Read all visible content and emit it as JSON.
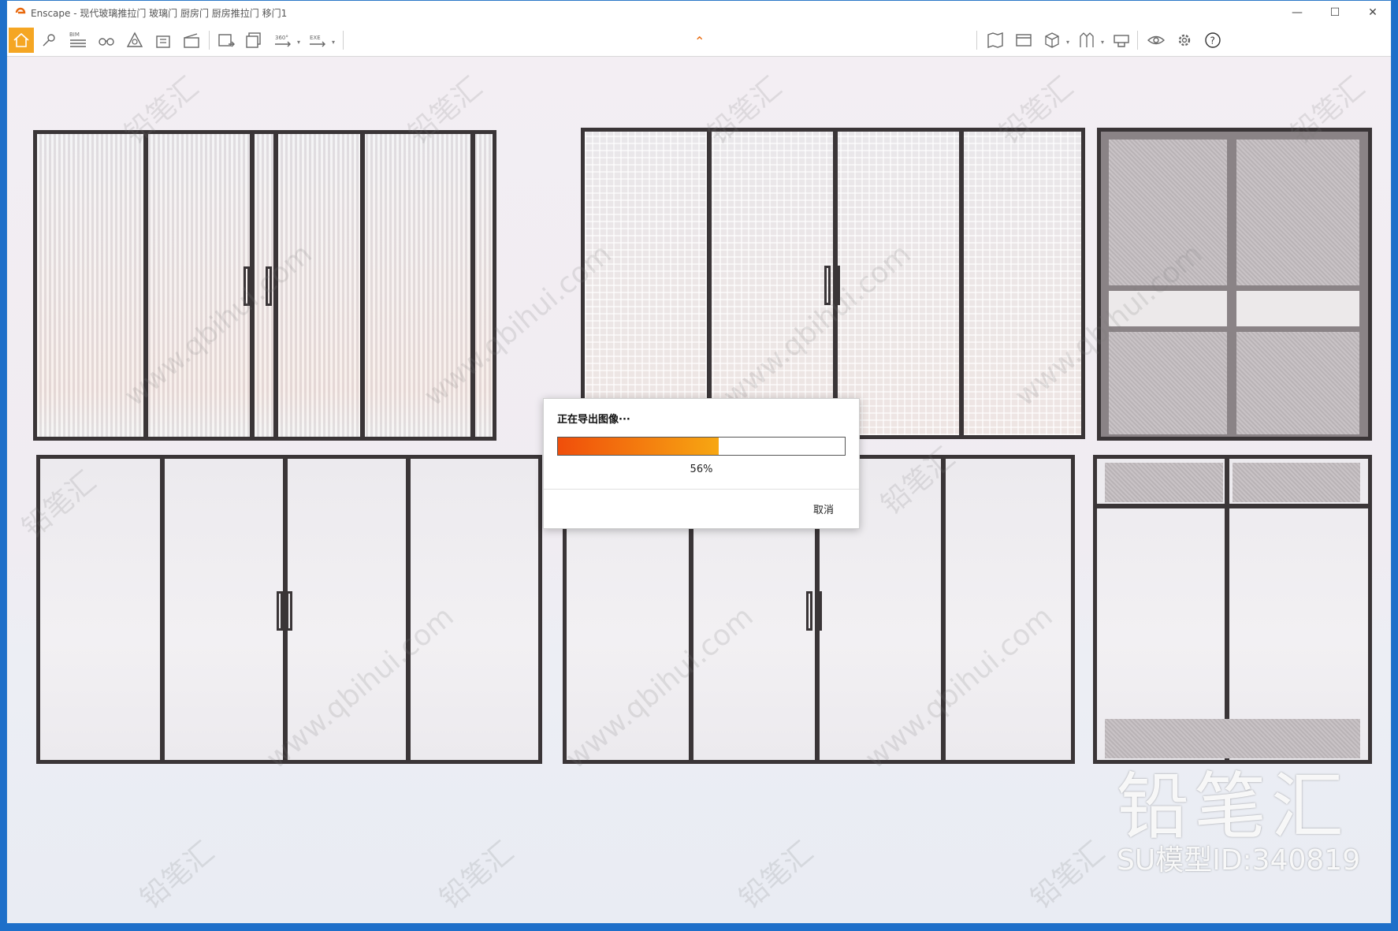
{
  "window": {
    "app_name": "Enscape",
    "title": "Enscape - 现代玻璃推拉门 玻璃门 厨房门 厨房推拉门 移门1",
    "minimize": "—",
    "maximize": "☐",
    "close": "✕"
  },
  "toolbar": {
    "bim_label": "BIM",
    "pano_label": "360°",
    "exe_label": "EXE",
    "help_label": "?"
  },
  "dialog": {
    "title": "正在导出图像···",
    "progress": 56,
    "progress_text": "56%",
    "cancel_label": "取消",
    "fill_start": "#f04e0b",
    "fill_end": "#f7a712"
  },
  "watermark": {
    "brand": "铅笔汇",
    "url": "www.qbihui.com",
    "model_id": "SU模型ID:340819"
  },
  "colors": {
    "accent": "#e8680c",
    "home_bg": "#f5a623",
    "desktop": "#1e6fc9"
  }
}
